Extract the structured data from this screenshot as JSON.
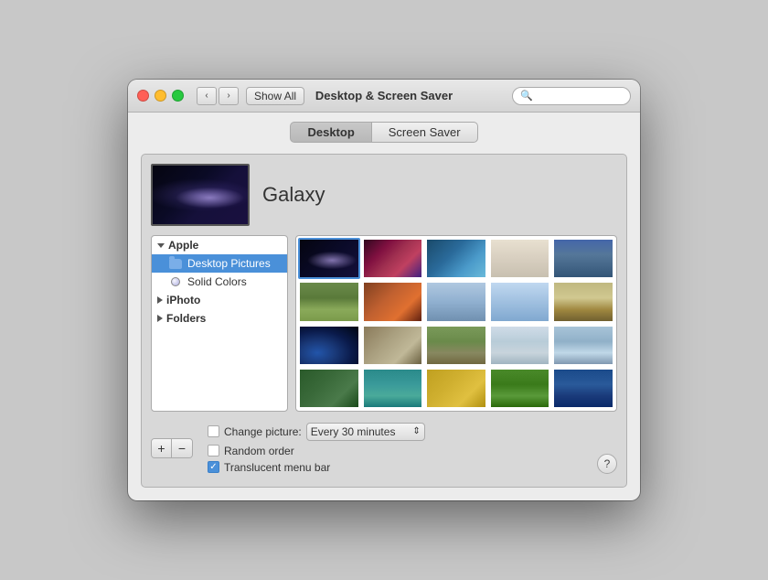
{
  "window": {
    "title": "Desktop & Screen Saver"
  },
  "titlebar": {
    "show_all_label": "Show All",
    "search_placeholder": ""
  },
  "tabs": [
    {
      "id": "desktop",
      "label": "Desktop",
      "active": true
    },
    {
      "id": "screen-saver",
      "label": "Screen Saver",
      "active": false
    }
  ],
  "preview": {
    "label": "Galaxy"
  },
  "sidebar": {
    "sections": [
      {
        "id": "apple",
        "label": "Apple",
        "expanded": true,
        "items": [
          {
            "id": "desktop-pictures",
            "label": "Desktop Pictures",
            "type": "folder",
            "selected": true
          },
          {
            "id": "solid-colors",
            "label": "Solid Colors",
            "type": "circle",
            "selected": false
          }
        ]
      },
      {
        "id": "iphoto",
        "label": "iPhoto",
        "expanded": false,
        "items": []
      },
      {
        "id": "folders",
        "label": "Folders",
        "expanded": false,
        "items": []
      }
    ]
  },
  "bottom": {
    "add_label": "+",
    "remove_label": "−",
    "change_picture_label": "Change picture:",
    "change_interval_label": "Every 30 minutes",
    "random_order_label": "Random order",
    "translucent_menu_label": "Translucent menu bar",
    "change_checked": false,
    "random_checked": false,
    "translucent_checked": true,
    "help_label": "?"
  }
}
